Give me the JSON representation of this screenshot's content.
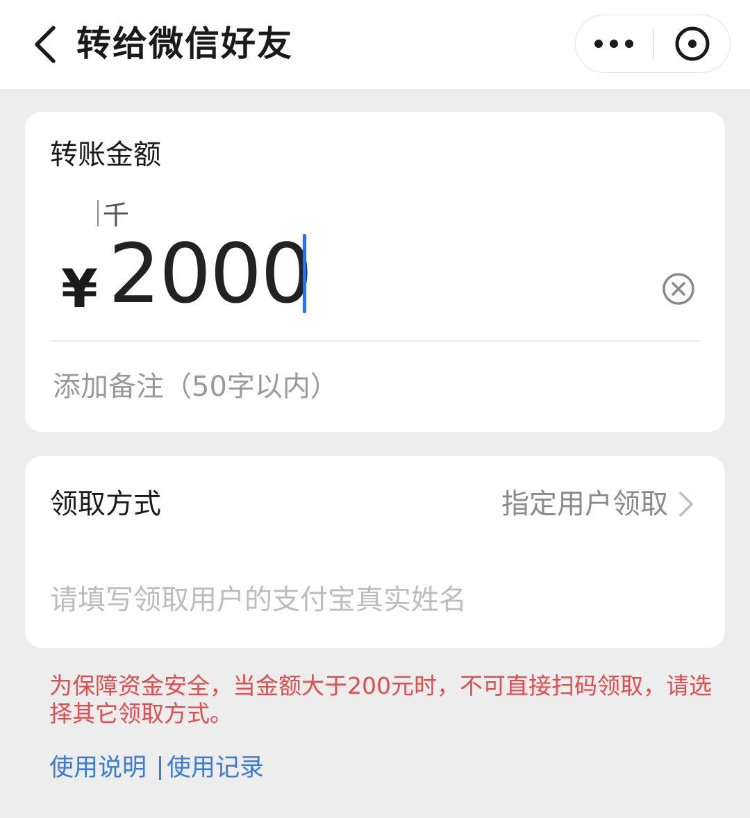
{
  "header": {
    "title": "转给微信好友",
    "back_icon": "chevron-left-icon",
    "more_icon": "more-dots-icon",
    "close_icon": "close-circle-icon"
  },
  "amount_card": {
    "label": "转账金额",
    "unit_hint": "千",
    "currency": "¥",
    "amount": "2000",
    "clear_icon": "clear-circle-icon",
    "note_placeholder": "添加备注（50字以内）"
  },
  "receive_card": {
    "label": "领取方式",
    "value": "指定用户领取",
    "chevron_icon": "chevron-right-icon",
    "name_placeholder": "请填写领取用户的支付宝真实姓名"
  },
  "warning": {
    "text": "为保障资金安全，当金额大于200元时，不可直接扫码领取，请选择其它领取方式。",
    "color": "#e34d4d"
  },
  "links": {
    "instructions": "使用说明",
    "records": "使用记录",
    "color": "#3b7bd8"
  },
  "colors": {
    "background": "#ededed",
    "card": "#ffffff",
    "caret": "#2f6fe0"
  }
}
